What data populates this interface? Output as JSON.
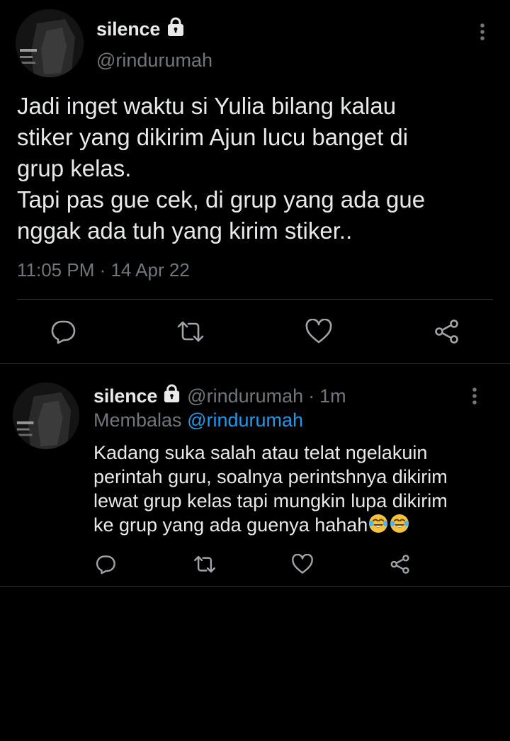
{
  "main_tweet": {
    "display_name": "silence",
    "handle": "@rindurumah",
    "text": "Jadi inget waktu si Yulia bilang kalau\nstiker yang dikirim Ajun lucu banget di\ngrup kelas.\nTapi pas gue cek, di grup yang ada gue\nnggak ada tuh yang kirim stiker..",
    "timestamp": "11:05 PM · 14 Apr 22",
    "actions": [
      "reply-icon",
      "retweet-icon",
      "like-icon",
      "share-icon"
    ]
  },
  "reply": {
    "display_name": "silence",
    "handle": "@rindurumah",
    "separator": "·",
    "time_ago": "1m",
    "replying_to_label": "Membalas",
    "replying_to_mention": "@rindurumah",
    "text": "Kadang suka salah atau telat ngelakuin\nperintah guru, soalnya perintshnya dikirim\nlewat grup kelas tapi mungkin lupa dikirim\nke grup yang ada guenya hahah",
    "emoji": [
      "face-with-tears-of-joy",
      "face-with-tears-of-joy"
    ],
    "actions": [
      "reply-icon",
      "retweet-icon",
      "like-icon",
      "share-icon"
    ]
  },
  "colors": {
    "background": "#000000",
    "primary_text": "#e7e9ea",
    "secondary_text": "#71767b",
    "accent": "#1d9bf0",
    "divider": "#2f3336"
  }
}
